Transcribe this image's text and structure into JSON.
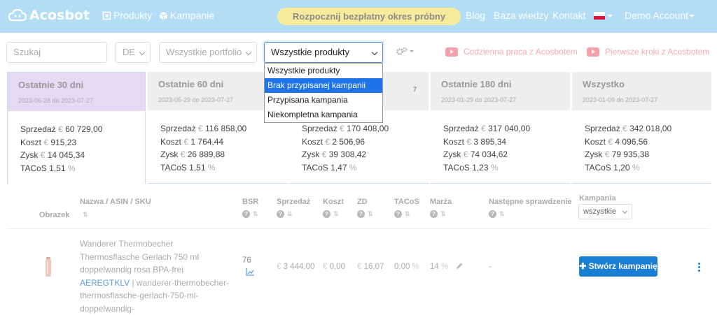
{
  "nav": {
    "brand": "Acosbot",
    "products": "Produkty",
    "campaigns": "Kampanie",
    "trial_button": "Rozpocznij bezpłatny okres próbny",
    "blog": "Blog",
    "knowledge_base": "Baza wiedzy",
    "contact": "Kontakt",
    "account": "Demo Account"
  },
  "filters": {
    "search_placeholder": "Szukaj",
    "marketplace": "DE",
    "portfolio": "Wszystkie portfolio",
    "product_filter": "Wszystkie produkty",
    "video1": "Codzienna praca z Acosbotem",
    "video2": "Pierwsze kroki z Acosbotem"
  },
  "dropdown": {
    "options": [
      "Wszystkie produkty",
      "Brak przypisanej kampanii",
      "Przypisana kampania",
      "Niekompletna kampania"
    ],
    "highlighted_index": 1
  },
  "labels": {
    "sales": "Sprzedaż",
    "cost": "Koszt",
    "profit": "Zysk",
    "tacos": "TACoS",
    "currency": "€",
    "percent": "%"
  },
  "cards": [
    {
      "title": "Ostatnie 30 dni",
      "dates": "2023-06-28 do 2023-07-27",
      "sales": "60 729,00",
      "cost": "915,23",
      "profit": "14 045,34",
      "tacos": "1,51"
    },
    {
      "title": "Ostatnie 60 dni",
      "dates": "2023-05-29 do 2023-07-27",
      "sales": "116 858,00",
      "cost": "1 764,44",
      "profit": "26 889,88",
      "tacos": "1,51"
    },
    {
      "title": "",
      "dates": "",
      "dates_tail": "7",
      "sales": "170 408,00",
      "cost": "2 506,96",
      "profit": "39 308,42",
      "tacos": "1,47"
    },
    {
      "title": "Ostatnie 180 dni",
      "dates": "2023-01-29 do 2023-07-27",
      "sales": "317 040,00",
      "cost": "3 895,34",
      "profit": "74 034,62",
      "tacos": "1,23"
    },
    {
      "title": "Wszystko",
      "dates": "2023-01-09 do 2023-07-27",
      "sales": "342 018,00",
      "cost": "4 096,56",
      "profit": "79 935,38",
      "tacos": "1,20"
    }
  ],
  "table": {
    "headers": {
      "image": "Obrazek",
      "name": "Nazwa / ASIN / SKU",
      "bsr": "BSR",
      "sales": "Sprzedaż",
      "cost": "Koszt",
      "zd": "ZD",
      "tacos": "TACoS",
      "margin": "Marża",
      "next_check": "Następne sprawdzenie",
      "campaign": "Kampania"
    },
    "campaign_filter": "wszystkie",
    "row": {
      "name": "Wanderer Thermobecher Thermosflasche Gerlach 750 ml doppelwandig rosa BPA-frei",
      "asin": "AEREGTKLV",
      "sku": " | wanderer-thermobecher-thermosflasche-gerlach-750-ml-doppelwandig-",
      "bsr": "76",
      "sales": "3 444,00",
      "cost": "0,00",
      "zd": "16,07",
      "tacos": "0,00",
      "margin": "14",
      "next_check": "-",
      "create_button": "Stwórz kampanię"
    }
  }
}
